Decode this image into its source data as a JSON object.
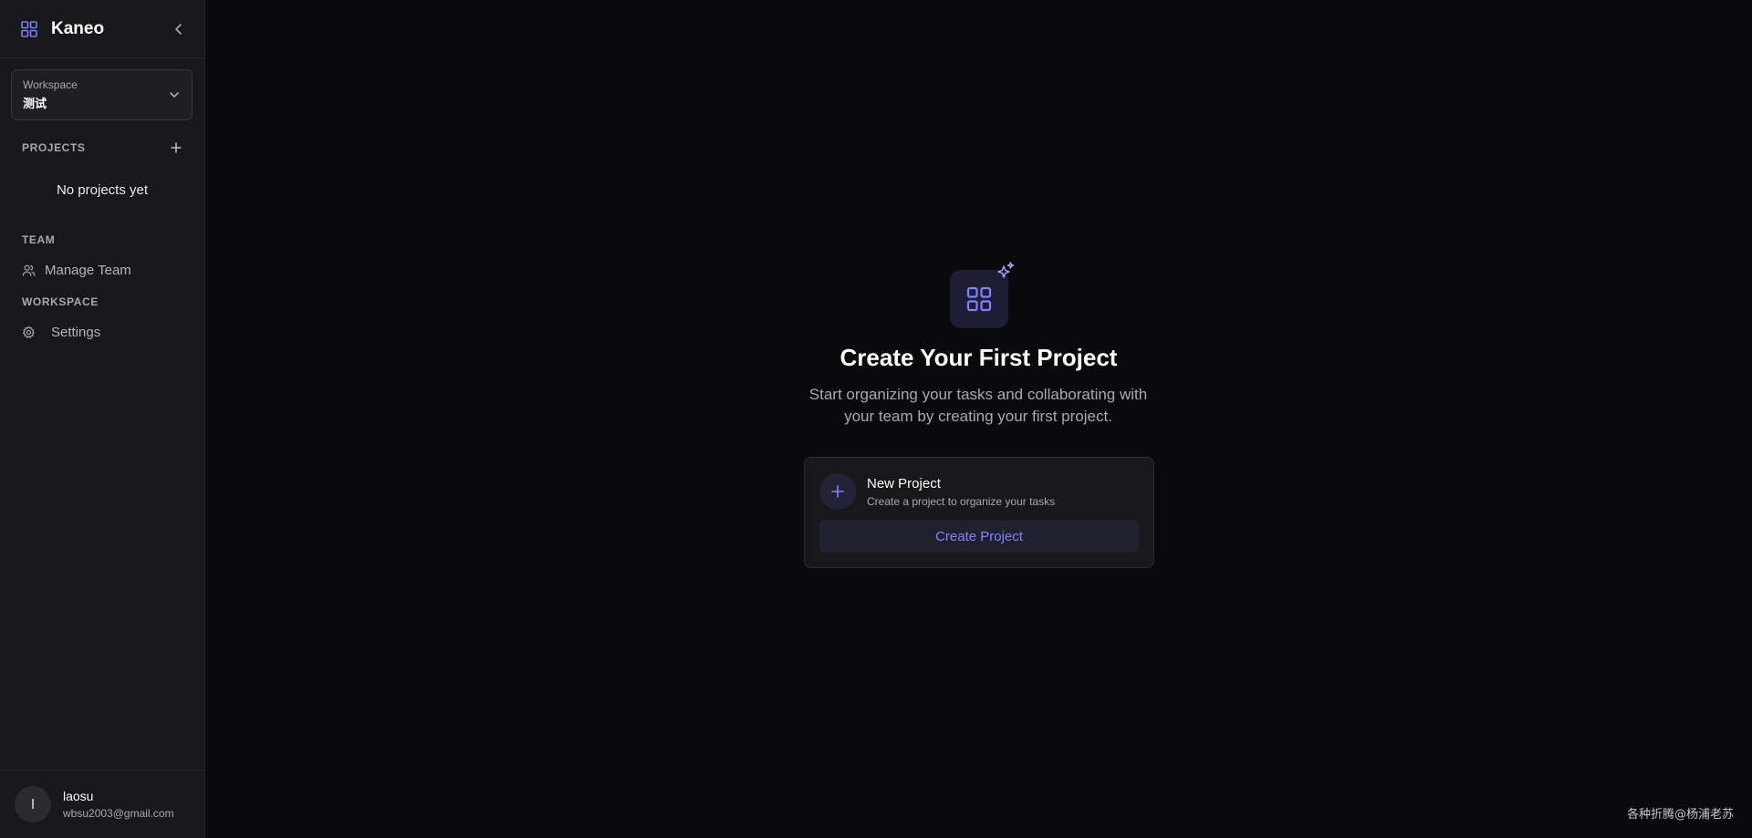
{
  "app": {
    "name": "Kaneo"
  },
  "workspace_select": {
    "label": "Workspace",
    "value": "测试"
  },
  "sidebar": {
    "projects_heading": "PROJECTS",
    "projects_empty": "No projects yet",
    "team_heading": "TEAM",
    "team_items": [
      {
        "label": "Manage Team",
        "icon": "users-icon"
      }
    ],
    "workspace_heading": "WORKSPACE",
    "workspace_items": [
      {
        "label": "Settings",
        "icon": "gear-icon"
      }
    ]
  },
  "user": {
    "initial": "l",
    "name": "laosu",
    "email": "wbsu2003@gmail.com"
  },
  "main": {
    "title": "Create Your First Project",
    "description": "Start organizing your tasks and collaborating with your team by creating your first project.",
    "card": {
      "title": "New Project",
      "subtitle": "Create a project to organize your tasks",
      "button_label": "Create Project"
    }
  },
  "watermark": "各种折腾@杨浦老苏",
  "colors": {
    "accent": "#8083ff",
    "background": "#0a0a0c",
    "sidebar": "#18181b"
  }
}
